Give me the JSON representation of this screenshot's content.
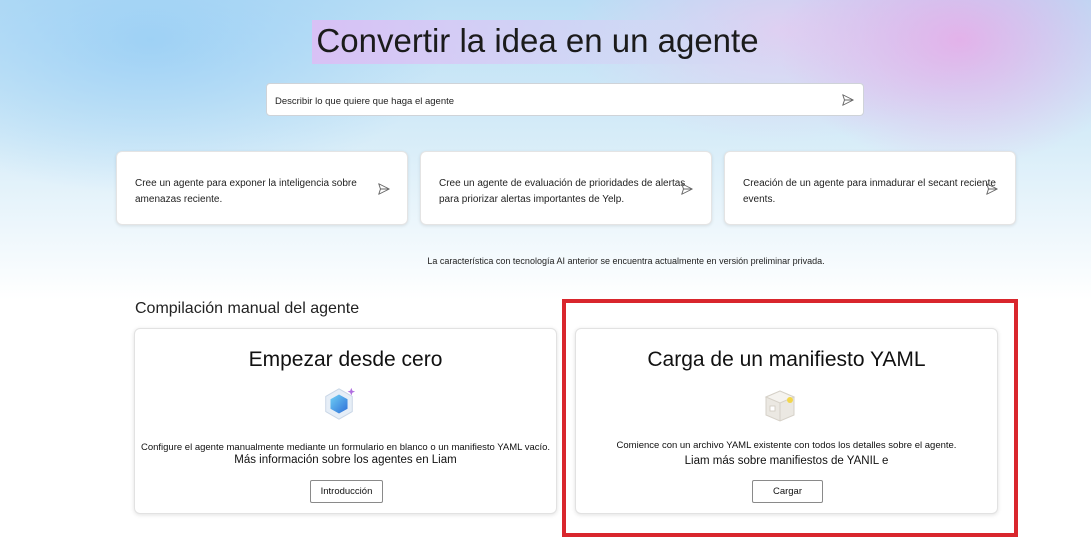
{
  "header": {
    "title": "Convertir la idea en un agente"
  },
  "prompt": {
    "placeholder": "Describir lo que quiere que haga el agente",
    "send_icon": "send-icon"
  },
  "suggestions": [
    {
      "text": "Cree un agente para exponer la inteligencia sobre amenazas reciente."
    },
    {
      "text": "Cree un agente de evaluación de prioridades de alertas para priorizar alertas importantes de Yelp."
    },
    {
      "text": "Creación de un agente para inmadurar el secant reciente events."
    }
  ],
  "notice": "La característica con tecnología AI anterior se encuentra actualmente en versión preliminar privada.",
  "manual": {
    "section_title": "Compilación manual del agente",
    "scratch": {
      "title": "Empezar desde cero",
      "icon": "agent-hexagon-icon",
      "description": "Configure el agente manualmente mediante un formulario en blanco o un manifiesto YAML vacío.",
      "link": "Más información sobre los agentes en Liam",
      "button": "Introducción"
    },
    "yaml": {
      "title": "Carga de un manifiesto YAML",
      "icon": "package-box-icon",
      "description": "Comience con un archivo YAML existente con todos los detalles sobre el agente.",
      "link": "Liam más sobre manifiestos de YANIL e",
      "button": "Cargar"
    }
  },
  "colors": {
    "highlight": "#d9262d",
    "accent": "#3b82d6"
  }
}
